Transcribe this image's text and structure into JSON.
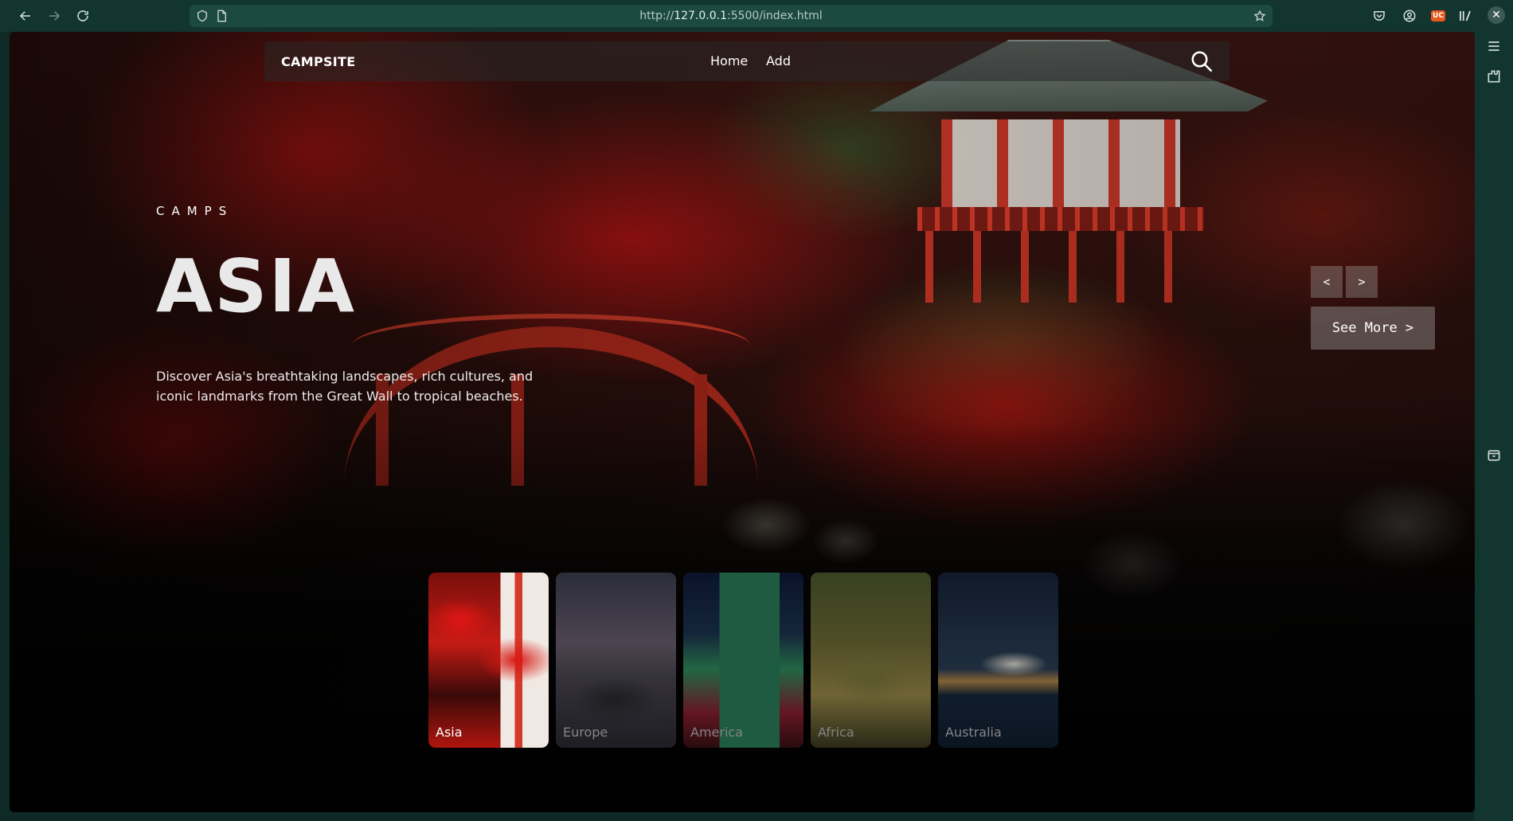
{
  "browser": {
    "url_prefix": "http://",
    "url_host": "127.0.0.1",
    "url_rest": ":5500/index.html",
    "extension_uc_label": "UC",
    "close_glyph": "✕"
  },
  "site": {
    "brand": "CAMPSITE",
    "nav": [
      {
        "label": "Home"
      },
      {
        "label": "Add"
      }
    ]
  },
  "hero": {
    "kicker": "CAMPS",
    "title": "ASIA",
    "description": "Discover Asia's breathtaking landscapes, rich cultures, and iconic landmarks from the Great Wall to tropical beaches.",
    "prev_label": "<",
    "next_label": ">",
    "see_more_label": "See More >"
  },
  "thumbnails": [
    {
      "label": "Asia",
      "active": true
    },
    {
      "label": "Europe",
      "active": false
    },
    {
      "label": "America",
      "active": false
    },
    {
      "label": "Africa",
      "active": false
    },
    {
      "label": "Australia",
      "active": false
    }
  ],
  "colors": {
    "browser_chrome": "#123530",
    "url_bar": "#1c4a43",
    "accent_red": "#c41b15",
    "uc_badge": "#e65a1e"
  }
}
